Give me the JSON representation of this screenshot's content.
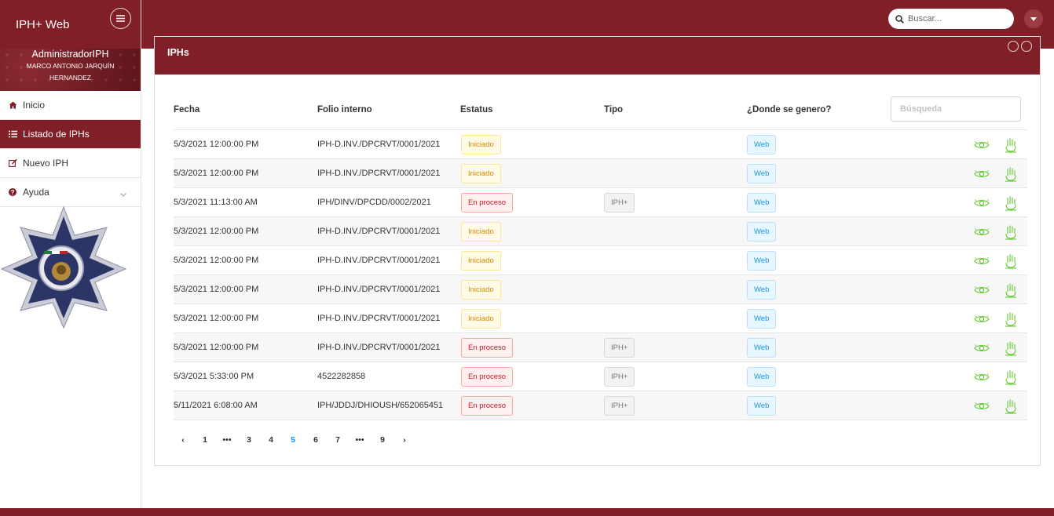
{
  "app": {
    "title": "IPH+ Web"
  },
  "user": {
    "role": "AdministradorIPH",
    "name": "MARCO ANTONIO JARQUÍN HERNANDEZ"
  },
  "sidebar": {
    "items": [
      {
        "label": "Inicio",
        "icon": "home-icon"
      },
      {
        "label": "Listado de IPHs",
        "icon": "list-icon",
        "active": true
      },
      {
        "label": "Nuevo IPH",
        "icon": "edit-icon"
      },
      {
        "label": "Ayuda",
        "icon": "question-circle-icon"
      }
    ]
  },
  "topbar": {
    "search_placeholder": "Buscar..."
  },
  "card": {
    "title": "IPHs"
  },
  "table": {
    "columns": [
      "Fecha",
      "Folio interno",
      "Estatus",
      "Tipo",
      "¿Donde se genero?"
    ],
    "filter_placeholder": "Búsqueda",
    "rows": [
      {
        "fecha": "5/3/2021 12:00:00 PM",
        "folio": "IPH-D.INV./DPCRVT/0001/2021",
        "estatus": "Iniciado",
        "tipo": "",
        "donde": "Web"
      },
      {
        "fecha": "5/3/2021 12:00:00 PM",
        "folio": "IPH-D.INV./DPCRVT/0001/2021",
        "estatus": "Iniciado",
        "tipo": "",
        "donde": "Web"
      },
      {
        "fecha": "5/3/2021 11:13:00 AM",
        "folio": "IPH/DINV/DPCDD/0002/2021",
        "estatus": "En proceso",
        "tipo": "IPH+",
        "donde": "Web"
      },
      {
        "fecha": "5/3/2021 12:00:00 PM",
        "folio": "IPH-D.INV./DPCRVT/0001/2021",
        "estatus": "Iniciado",
        "tipo": "",
        "donde": "Web"
      },
      {
        "fecha": "5/3/2021 12:00:00 PM",
        "folio": "IPH-D.INV./DPCRVT/0001/2021",
        "estatus": "Iniciado",
        "tipo": "",
        "donde": "Web"
      },
      {
        "fecha": "5/3/2021 12:00:00 PM",
        "folio": "IPH-D.INV./DPCRVT/0001/2021",
        "estatus": "Iniciado",
        "tipo": "",
        "donde": "Web"
      },
      {
        "fecha": "5/3/2021 12:00:00 PM",
        "folio": "IPH-D.INV./DPCRVT/0001/2021",
        "estatus": "Iniciado",
        "tipo": "",
        "donde": "Web"
      },
      {
        "fecha": "5/3/2021 12:00:00 PM",
        "folio": "IPH-D.INV./DPCRVT/0001/2021",
        "estatus": "En proceso",
        "tipo": "IPH+",
        "donde": "Web"
      },
      {
        "fecha": "5/3/2021 5:33:00 PM",
        "folio": "4522282858",
        "estatus": "En proceso",
        "tipo": "IPH+",
        "donde": "Web"
      },
      {
        "fecha": "5/11/2021 6:08:00 AM",
        "folio": "IPH/JDDJ/DHIOUSH/652065451",
        "estatus": "En proceso",
        "tipo": "IPH+",
        "donde": "Web"
      }
    ]
  },
  "pagination": {
    "items": [
      "‹",
      "1",
      "•••",
      "3",
      "4",
      "5",
      "6",
      "7",
      "•••",
      "9",
      "›"
    ],
    "current": "5"
  },
  "colors": {
    "brand": "#801f27",
    "accent": "#1890ff",
    "action": "#52c41a"
  }
}
